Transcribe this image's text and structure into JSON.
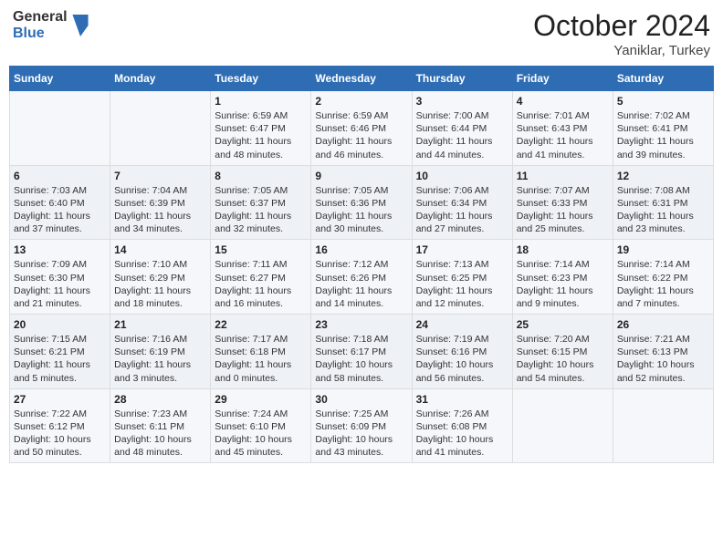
{
  "header": {
    "logo_general": "General",
    "logo_blue": "Blue",
    "month_year": "October 2024",
    "location": "Yaniklar, Turkey"
  },
  "days_of_week": [
    "Sunday",
    "Monday",
    "Tuesday",
    "Wednesday",
    "Thursday",
    "Friday",
    "Saturday"
  ],
  "weeks": [
    [
      {
        "day": "",
        "detail": ""
      },
      {
        "day": "",
        "detail": ""
      },
      {
        "day": "1",
        "detail": "Sunrise: 6:59 AM\nSunset: 6:47 PM\nDaylight: 11 hours and 48 minutes."
      },
      {
        "day": "2",
        "detail": "Sunrise: 6:59 AM\nSunset: 6:46 PM\nDaylight: 11 hours and 46 minutes."
      },
      {
        "day": "3",
        "detail": "Sunrise: 7:00 AM\nSunset: 6:44 PM\nDaylight: 11 hours and 44 minutes."
      },
      {
        "day": "4",
        "detail": "Sunrise: 7:01 AM\nSunset: 6:43 PM\nDaylight: 11 hours and 41 minutes."
      },
      {
        "day": "5",
        "detail": "Sunrise: 7:02 AM\nSunset: 6:41 PM\nDaylight: 11 hours and 39 minutes."
      }
    ],
    [
      {
        "day": "6",
        "detail": "Sunrise: 7:03 AM\nSunset: 6:40 PM\nDaylight: 11 hours and 37 minutes."
      },
      {
        "day": "7",
        "detail": "Sunrise: 7:04 AM\nSunset: 6:39 PM\nDaylight: 11 hours and 34 minutes."
      },
      {
        "day": "8",
        "detail": "Sunrise: 7:05 AM\nSunset: 6:37 PM\nDaylight: 11 hours and 32 minutes."
      },
      {
        "day": "9",
        "detail": "Sunrise: 7:05 AM\nSunset: 6:36 PM\nDaylight: 11 hours and 30 minutes."
      },
      {
        "day": "10",
        "detail": "Sunrise: 7:06 AM\nSunset: 6:34 PM\nDaylight: 11 hours and 27 minutes."
      },
      {
        "day": "11",
        "detail": "Sunrise: 7:07 AM\nSunset: 6:33 PM\nDaylight: 11 hours and 25 minutes."
      },
      {
        "day": "12",
        "detail": "Sunrise: 7:08 AM\nSunset: 6:31 PM\nDaylight: 11 hours and 23 minutes."
      }
    ],
    [
      {
        "day": "13",
        "detail": "Sunrise: 7:09 AM\nSunset: 6:30 PM\nDaylight: 11 hours and 21 minutes."
      },
      {
        "day": "14",
        "detail": "Sunrise: 7:10 AM\nSunset: 6:29 PM\nDaylight: 11 hours and 18 minutes."
      },
      {
        "day": "15",
        "detail": "Sunrise: 7:11 AM\nSunset: 6:27 PM\nDaylight: 11 hours and 16 minutes."
      },
      {
        "day": "16",
        "detail": "Sunrise: 7:12 AM\nSunset: 6:26 PM\nDaylight: 11 hours and 14 minutes."
      },
      {
        "day": "17",
        "detail": "Sunrise: 7:13 AM\nSunset: 6:25 PM\nDaylight: 11 hours and 12 minutes."
      },
      {
        "day": "18",
        "detail": "Sunrise: 7:14 AM\nSunset: 6:23 PM\nDaylight: 11 hours and 9 minutes."
      },
      {
        "day": "19",
        "detail": "Sunrise: 7:14 AM\nSunset: 6:22 PM\nDaylight: 11 hours and 7 minutes."
      }
    ],
    [
      {
        "day": "20",
        "detail": "Sunrise: 7:15 AM\nSunset: 6:21 PM\nDaylight: 11 hours and 5 minutes."
      },
      {
        "day": "21",
        "detail": "Sunrise: 7:16 AM\nSunset: 6:19 PM\nDaylight: 11 hours and 3 minutes."
      },
      {
        "day": "22",
        "detail": "Sunrise: 7:17 AM\nSunset: 6:18 PM\nDaylight: 11 hours and 0 minutes."
      },
      {
        "day": "23",
        "detail": "Sunrise: 7:18 AM\nSunset: 6:17 PM\nDaylight: 10 hours and 58 minutes."
      },
      {
        "day": "24",
        "detail": "Sunrise: 7:19 AM\nSunset: 6:16 PM\nDaylight: 10 hours and 56 minutes."
      },
      {
        "day": "25",
        "detail": "Sunrise: 7:20 AM\nSunset: 6:15 PM\nDaylight: 10 hours and 54 minutes."
      },
      {
        "day": "26",
        "detail": "Sunrise: 7:21 AM\nSunset: 6:13 PM\nDaylight: 10 hours and 52 minutes."
      }
    ],
    [
      {
        "day": "27",
        "detail": "Sunrise: 7:22 AM\nSunset: 6:12 PM\nDaylight: 10 hours and 50 minutes."
      },
      {
        "day": "28",
        "detail": "Sunrise: 7:23 AM\nSunset: 6:11 PM\nDaylight: 10 hours and 48 minutes."
      },
      {
        "day": "29",
        "detail": "Sunrise: 7:24 AM\nSunset: 6:10 PM\nDaylight: 10 hours and 45 minutes."
      },
      {
        "day": "30",
        "detail": "Sunrise: 7:25 AM\nSunset: 6:09 PM\nDaylight: 10 hours and 43 minutes."
      },
      {
        "day": "31",
        "detail": "Sunrise: 7:26 AM\nSunset: 6:08 PM\nDaylight: 10 hours and 41 minutes."
      },
      {
        "day": "",
        "detail": ""
      },
      {
        "day": "",
        "detail": ""
      }
    ]
  ]
}
